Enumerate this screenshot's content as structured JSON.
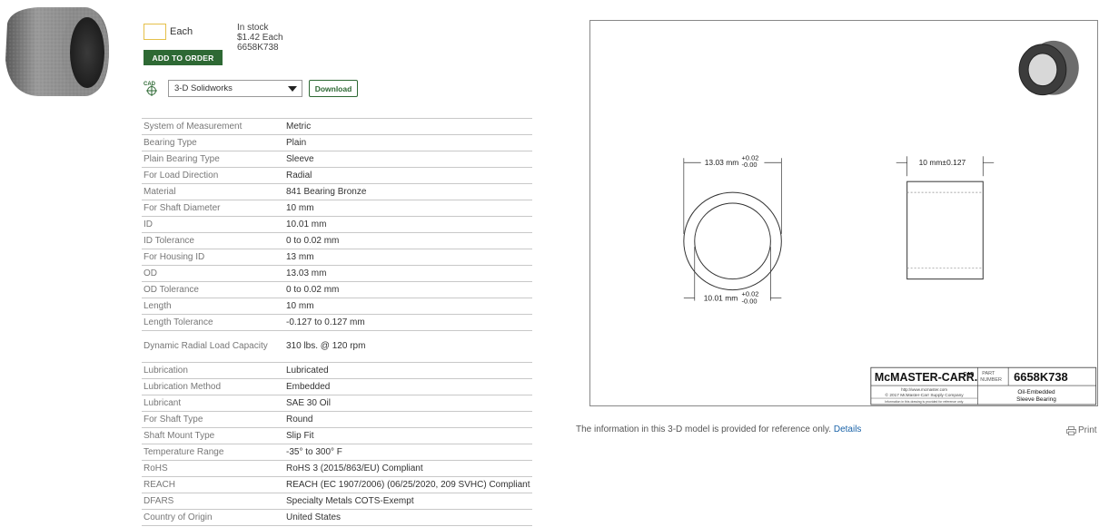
{
  "order": {
    "quantity_value": "",
    "unit_label": "Each",
    "stock_status": "In stock",
    "price": "$1.42 Each",
    "part_number": "6658K738",
    "add_button_label": "ADD TO ORDER"
  },
  "cad": {
    "icon_label": "CAD",
    "selected_format": "3-D Solidworks",
    "download_label": "Download"
  },
  "specs": [
    {
      "label": "System of Measurement",
      "value": "Metric"
    },
    {
      "label": "Bearing Type",
      "value": "Plain"
    },
    {
      "label": "Plain Bearing Type",
      "value": "Sleeve"
    },
    {
      "label": "For Load Direction",
      "value": "Radial"
    },
    {
      "label": "Material",
      "value": "841 Bearing Bronze"
    },
    {
      "label": "For Shaft Diameter",
      "value": "10 mm"
    },
    {
      "label": "ID",
      "value": "10.01 mm"
    },
    {
      "label": "ID Tolerance",
      "value": "0 to 0.02 mm"
    },
    {
      "label": "For Housing ID",
      "value": "13 mm"
    },
    {
      "label": "OD",
      "value": "13.03 mm"
    },
    {
      "label": "OD Tolerance",
      "value": "0 to 0.02 mm"
    },
    {
      "label": "Length",
      "value": "10 mm"
    },
    {
      "label": "Length Tolerance",
      "value": "-0.127 to 0.127 mm"
    },
    {
      "label": "Dynamic Radial Load Capacity",
      "value": "310 lbs. @ 120 rpm"
    },
    {
      "label": "Lubrication",
      "value": "Lubricated"
    },
    {
      "label": "Lubrication Method",
      "value": "Embedded"
    },
    {
      "label": "Lubricant",
      "value": "SAE 30 Oil"
    },
    {
      "label": "For Shaft Type",
      "value": "Round"
    },
    {
      "label": "Shaft Mount Type",
      "value": "Slip Fit"
    },
    {
      "label": "Temperature Range",
      "value": "-35° to 300° F"
    },
    {
      "label": "RoHS",
      "value": "RoHS 3 (2015/863/EU) Compliant"
    },
    {
      "label": "REACH",
      "value": "REACH (EC 1907/2006) (06/25/2020, 209 SVHC) Compliant"
    },
    {
      "label": "DFARS",
      "value": "Specialty Metals COTS-Exempt"
    },
    {
      "label": "Country of Origin",
      "value": "United States"
    }
  ],
  "drawing": {
    "od_dim": "13.03 mm",
    "od_tol_plus": "+0.02",
    "od_tol_minus": "-0.00",
    "id_dim": "10.01 mm",
    "id_tol_plus": "+0.02",
    "id_tol_minus": "-0.00",
    "length_dim": "10 mm±0.127",
    "brand": "McMASTER-CARR.",
    "brand_cad": "CAD",
    "part_label_1": "PART",
    "part_label_2": "NUMBER",
    "part_number": "6658K738",
    "url": "http://www.mcmaster.com",
    "copyright": "© 2017 McMaster-Carr Supply Company",
    "fine_print": "Information in this drawing is provided for reference only.",
    "desc_1": "Oil-Embedded",
    "desc_2": "Sleeve Bearing"
  },
  "footer": {
    "notice": "The information in this 3-D model is provided for reference only.",
    "details_link": "Details",
    "print_label": "Print"
  },
  "colors": {
    "accent_green": "#2e6934",
    "link_blue": "#1a63a8",
    "input_border": "#e5c04a"
  }
}
